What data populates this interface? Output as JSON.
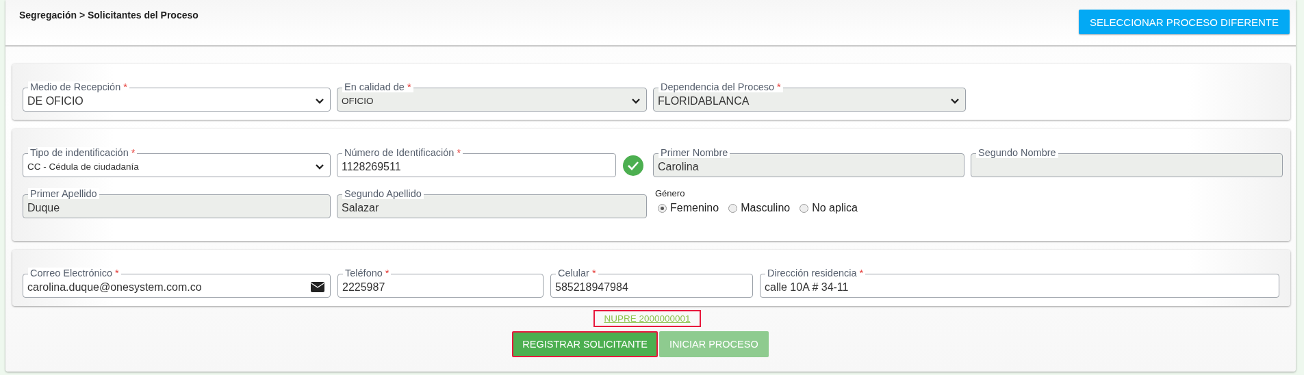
{
  "breadcrumb": "Segregación > Solicitantes del Proceso",
  "header_button": "SELECCIONAR PROCESO DIFERENTE",
  "sections": [
    {
      "fields": [
        {
          "kind": "select",
          "label": "Medio de Recepción",
          "mark": "*",
          "value": "DE OFICIO",
          "readonly": false,
          "small": false
        },
        {
          "kind": "select",
          "label": "En calidad de",
          "mark": "*",
          "value": "OFICIO",
          "readonly": true,
          "small": true
        },
        {
          "kind": "select",
          "label": "Dependencia del Proceso",
          "mark": "*",
          "value": "FLORIDABLANCA",
          "readonly": true,
          "small": false
        }
      ]
    },
    {
      "fields": [
        {
          "kind": "select",
          "label": "Tipo de indentificación",
          "mark": "*",
          "value": "CC - Cédula de ciudadanía",
          "readonly": false,
          "small": true
        },
        {
          "kind": "text",
          "label": "Número de Identificación",
          "mark": "*",
          "value": "1128269511",
          "readonly": false,
          "verified": true
        },
        {
          "kind": "text",
          "label": "Primer Nombre",
          "value": "Carolina",
          "readonly": true
        },
        {
          "kind": "text",
          "label": "Segundo Nombre",
          "readonly": true
        },
        {
          "kind": "text",
          "label": "Primer Apellido",
          "value": "Duque",
          "readonly": true
        },
        {
          "kind": "text",
          "label": "Segundo Apellido",
          "value": "Salazar",
          "readonly": true
        },
        {
          "kind": "radio-group",
          "label": "Género",
          "options": [
            {
              "label": "Femenino",
              "selected": true
            },
            {
              "label": "Masculino",
              "selected": false
            },
            {
              "label": "No aplica",
              "selected": false
            }
          ]
        }
      ]
    },
    {
      "fields": [
        {
          "kind": "email",
          "label": "Correo Electrónico",
          "mark": "*",
          "value": "carolina.duque@onesystem.com.co",
          "readonly": false
        },
        {
          "kind": "text",
          "label": "Teléfono",
          "mark": "*",
          "value": "2225987",
          "readonly": false
        },
        {
          "kind": "text",
          "label": "Celular",
          "mark": "*",
          "value": "585218947984",
          "readonly": false
        },
        {
          "kind": "text",
          "label": "Dirección residencia",
          "mark": "*",
          "value": "calle 10A # 34-11",
          "readonly": false
        }
      ]
    }
  ],
  "link": {
    "text": "NUPRE 2000000001",
    "highlighted": true
  },
  "buttons": [
    {
      "label": "REGISTRAR SOLICITANTE",
      "disabled": false,
      "highlighted": true
    },
    {
      "label": "INICIAR PROCESO",
      "disabled": true,
      "highlighted": false
    }
  ]
}
